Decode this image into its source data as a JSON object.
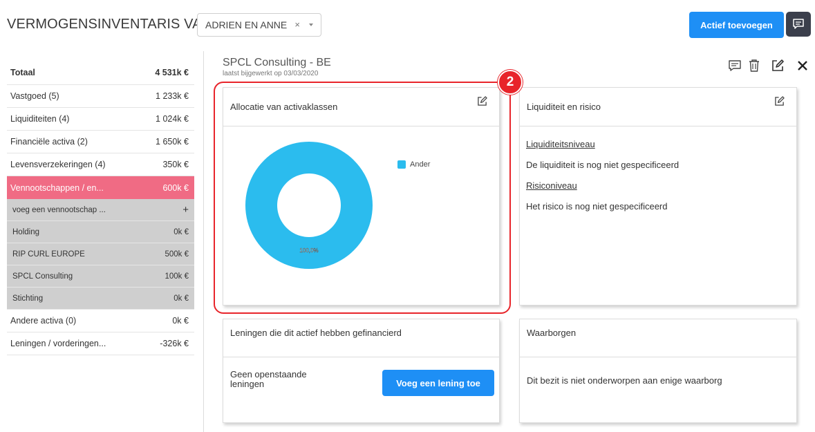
{
  "header": {
    "title": "VERMOGENSINVENTARIS VAN",
    "client": "ADRIEN EN ANNE",
    "clear_glyph": "×",
    "add_button": "Actief toevoegen",
    "comment_icon": "comment-icon"
  },
  "summary": {
    "total": {
      "label": "Totaal",
      "value": "4 531k €"
    },
    "rows": [
      {
        "label": "Vastgoed (5)",
        "value": "1 233k €"
      },
      {
        "label": "Liquiditeiten (4)",
        "value": "1 024k €"
      },
      {
        "label": "Financiële activa (2)",
        "value": "1 650k €"
      },
      {
        "label": "Levensverzekeringen (4)",
        "value": "350k €"
      },
      {
        "label": "Vennootschappen / en...",
        "value": "600k €"
      }
    ],
    "add_company": {
      "label": "voeg een vennootschap ...",
      "glyph": "+"
    },
    "companies": [
      {
        "label": "Holding",
        "value": "0k €"
      },
      {
        "label": "RIP CURL EUROPE",
        "value": "500k €"
      },
      {
        "label": "SPCL Consulting",
        "value": "100k €"
      },
      {
        "label": "Stichting",
        "value": "0k €"
      }
    ],
    "tail": [
      {
        "label": "Andere activa (0)",
        "value": "0k €"
      },
      {
        "label": "Leningen / vorderingen...",
        "value": "-326k €"
      }
    ]
  },
  "detail": {
    "title": "SPCL Consulting - BE",
    "updated": "laatst bijgewerkt op 03/03/2020",
    "icons": [
      "comment-icon",
      "trash-icon",
      "edit-icon",
      "close-icon"
    ]
  },
  "allocation": {
    "title": "Allocatie van activaklassen",
    "badge": "2",
    "legend": "Ander",
    "pie_label": "100,0%",
    "color": "#2bbcee"
  },
  "chart_data": {
    "type": "pie",
    "title": "",
    "categories": [
      "Ander"
    ],
    "values": [
      100.0
    ],
    "labels": [
      "100,0%"
    ],
    "donut": true,
    "legend": "right"
  },
  "liquidity": {
    "title": "Liquiditeit en risico",
    "level_heading": "Liquiditeitsniveau",
    "level_text": "De liquiditeit is nog niet gespecificeerd",
    "risk_heading": "Risiconiveau",
    "risk_text": "Het risico is nog niet gespecificeerd"
  },
  "loans": {
    "title": "Leningen die dit actief hebben gefinancierd",
    "empty_text": "Geen openstaande leningen",
    "add_button": "Voeg een lening toe"
  },
  "guarantees": {
    "title": "Waarborgen",
    "text": "Dit bezit is niet onderworpen aan enige waarborg"
  },
  "colors": {
    "accent": "#1e8ff5",
    "active_row": "#f06b84",
    "highlight": "#e8242a",
    "dark_button": "#3b3f4c"
  }
}
